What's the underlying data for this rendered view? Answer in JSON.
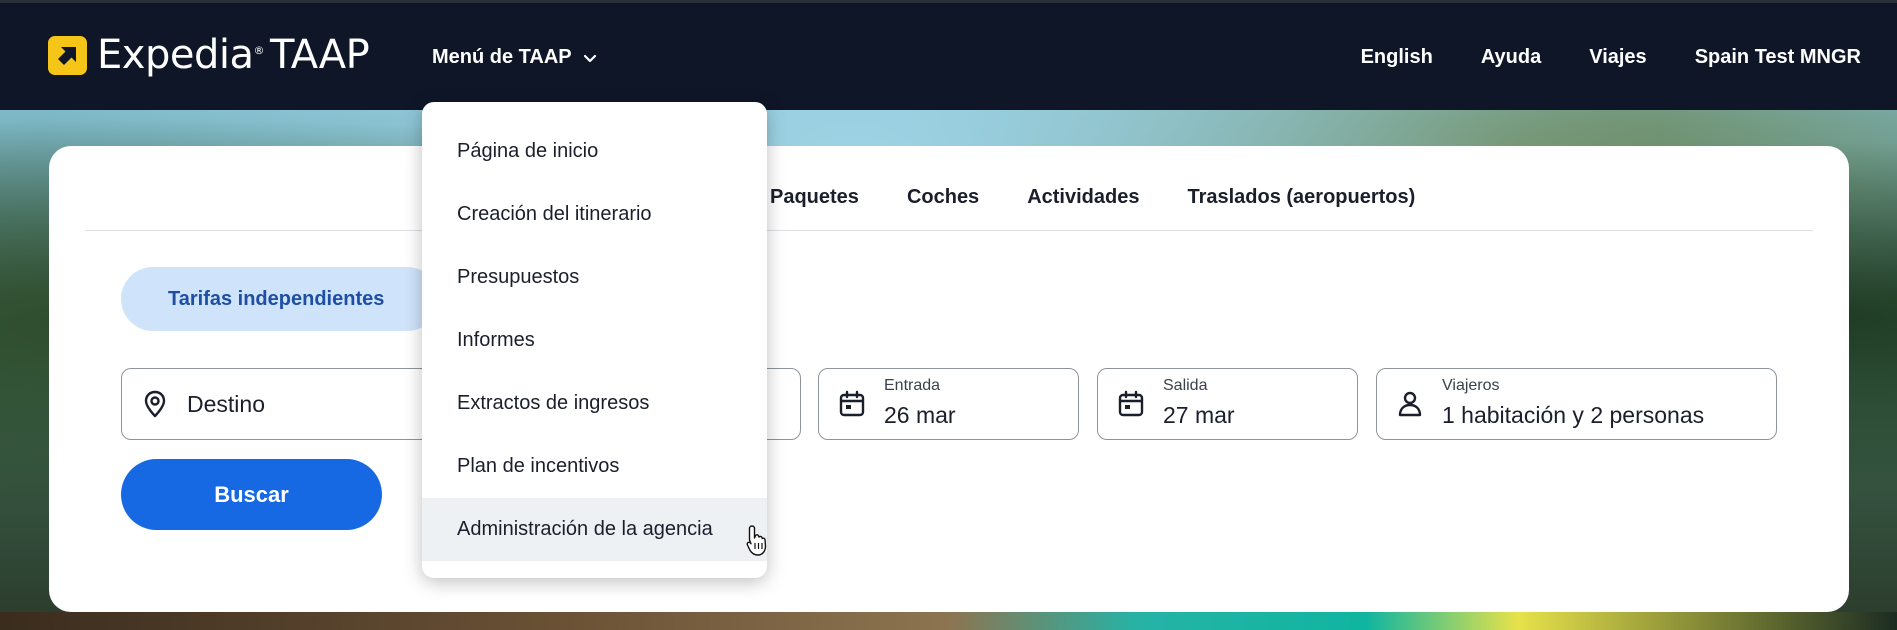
{
  "header": {
    "logo_text": "Expedia",
    "logo_registered": "®",
    "logo_suffix": "TAAP",
    "menu_label": "Menú de TAAP",
    "nav": [
      "English",
      "Ayuda",
      "Viajes",
      "Spain Test MNGR"
    ]
  },
  "icons": {
    "logo": "expedia-arrow-icon",
    "menu_chevron": "chevron-down-icon",
    "destination": "map-pin-icon",
    "checkin": "calendar-icon",
    "checkout": "calendar-icon",
    "travelers": "person-icon",
    "cursor": "hand-pointer-icon"
  },
  "colors": {
    "header_bg": "#0f1628",
    "logo_yellow": "#f5c518",
    "primary_button": "#1668e3",
    "pill_bg": "#cfe3fa",
    "pill_text": "#1e4fa3"
  },
  "dropdown": {
    "items": [
      "Página de inicio",
      "Creación del itinerario",
      "Presupuestos",
      "Informes",
      "Extractos de ingresos",
      "Plan de incentivos",
      "Administración de la agencia"
    ]
  },
  "tabs": [
    "Paquetes",
    "Coches",
    "Actividades",
    "Traslados (aeropuertos)"
  ],
  "search": {
    "fare_pill": "Tarifas independientes",
    "destination_placeholder": "Destino",
    "checkin_label": "Entrada",
    "checkin_value": "26 mar",
    "checkout_label": "Salida",
    "checkout_value": "27 mar",
    "travelers_label": "Viajeros",
    "travelers_value": "1 habitación y 2 personas",
    "search_button": "Buscar"
  }
}
